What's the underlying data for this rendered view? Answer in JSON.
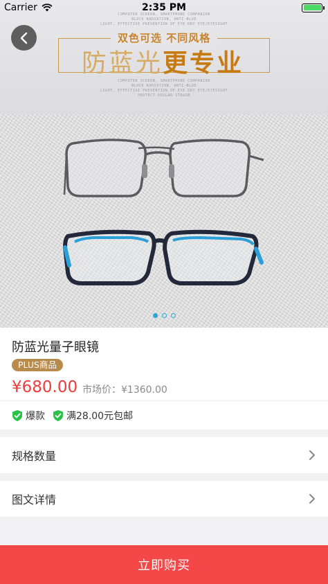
{
  "status_bar": {
    "carrier": "Carrier",
    "time": "2:35 PM",
    "battery_level": 1.0
  },
  "banner": {
    "tagline": "双色可选  不同风格",
    "headline_light": "防蓝光",
    "headline_bold": "更专业",
    "fine_text_top": [
      "COMPUTER SCREEN, SMARTPHONE COMPANION",
      "BLOCK RADIATION, ANTI-BLUE",
      "LIGHT, EFFECTIVE PREVENTION OF EYE DRY EYE/EYESIGHT"
    ],
    "fine_text_bottom": [
      "COMPUTER SCREEN, SMARTPHONE COMPANION",
      "BLOCK RADIATION, ANTI-BLUE",
      "LIGHT, EFFECTIVE PREVENTION OF EYE DRY EYE/EYESIGHT",
      "PROTECT OCULAR STRAIN"
    ]
  },
  "carousel": {
    "count": 3,
    "active_index": 0
  },
  "product": {
    "name": "防蓝光量子眼镜",
    "badge": "PLUS商品",
    "price": "¥680.00",
    "market_price": "市场价：¥1360.00",
    "tags": [
      "爆款",
      "满28.00元包邮"
    ]
  },
  "rows": {
    "spec": "规格数量",
    "detail": "图文详情"
  },
  "footer": {
    "buy_label": "立即购买"
  },
  "colors": {
    "accent": "#f44848",
    "price": "#f03b3b",
    "badge": "#b88a4c",
    "shield": "#2bc24a",
    "dot": "#2aa7d6"
  }
}
